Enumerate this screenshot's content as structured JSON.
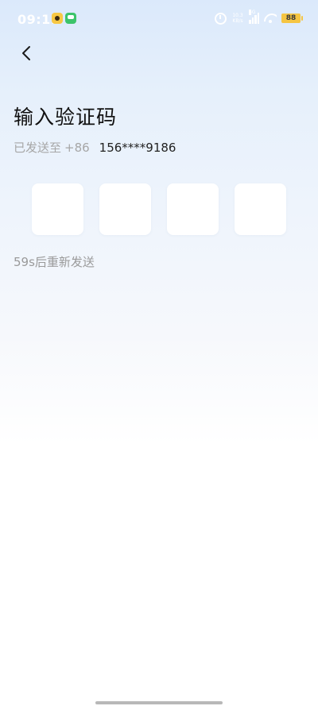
{
  "status_bar": {
    "time": "09:11",
    "net_speed_value": "10.3",
    "net_speed_unit": "KB/s",
    "network_type": "5G",
    "battery": "88"
  },
  "header": {
    "back_icon": "chevron-left-icon"
  },
  "page": {
    "title": "输入验证码",
    "sent_prefix": "已发送至",
    "country_code": "+86",
    "phone_number": "156****9186",
    "resend_text": "59s后重新发送"
  },
  "code_inputs": [
    "",
    "",
    "",
    ""
  ],
  "colors": {
    "title": "#111111",
    "muted": "#a6a6a6",
    "box_bg": "#ffffff",
    "battery": "#f5c542"
  }
}
